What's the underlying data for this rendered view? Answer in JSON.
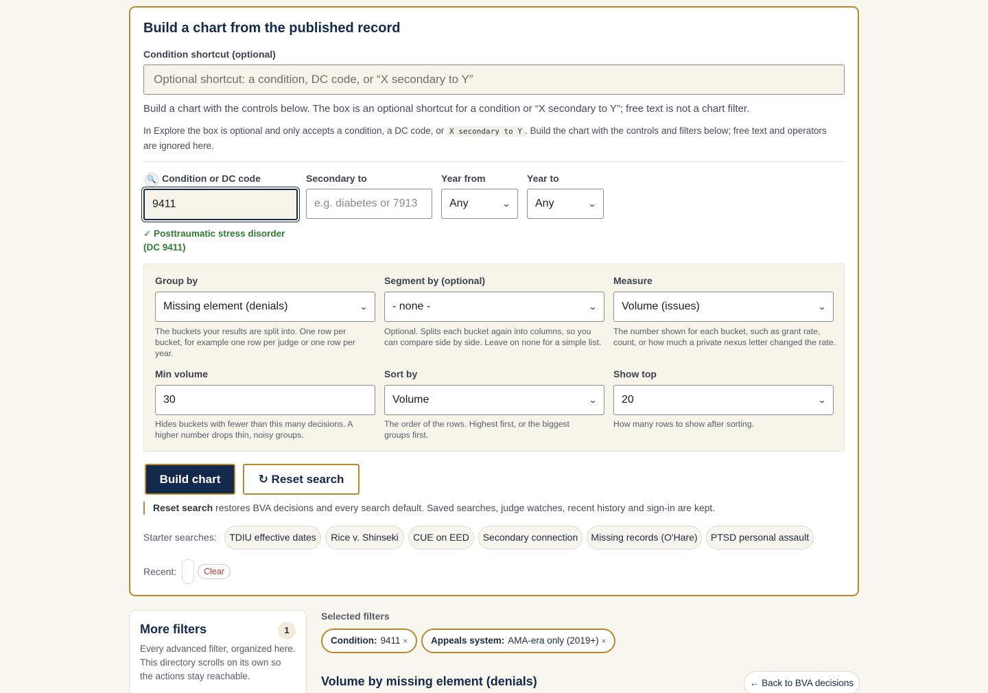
{
  "builder": {
    "title": "Build a chart from the published record",
    "shortcut_label": "Condition shortcut (optional)",
    "shortcut_placeholder": "Optional shortcut: a condition, DC code, or “X secondary to Y”",
    "help_line1": "Build a chart with the controls below. The box is an optional shortcut for a condition or “X secondary to Y”; free text is not a chart filter.",
    "help_line2_a": "In Explore the box is optional and only accepts a condition, a DC code, or ",
    "help_line2_code": "X secondary to Y",
    "help_line2_b": ". Build the chart with the controls and filters below; free text and operators are ignored here.",
    "condition_label": "Condition or DC code",
    "condition_value": "9411",
    "condition_match": "✓ Posttraumatic stress disorder (DC 9411)",
    "secondary_label": "Secondary to",
    "secondary_placeholder": "e.g. diabetes or 7913",
    "year_from_label": "Year from",
    "year_from_value": "Any",
    "year_to_label": "Year to",
    "year_to_value": "Any"
  },
  "options": {
    "group_by_label": "Group by",
    "group_by_value": "Missing element (denials)",
    "group_by_help": "The buckets your results are split into. One row per bucket, for example one row per judge or one row per year.",
    "segment_label": "Segment by (optional)",
    "segment_value": "- none -",
    "segment_help": "Optional. Splits each bucket again into columns, so you can compare side by side. Leave on none for a simple list.",
    "measure_label": "Measure",
    "measure_value": "Volume (issues)",
    "measure_help": "The number shown for each bucket, such as grant rate, count, or how much a private nexus letter changed the rate.",
    "min_volume_label": "Min volume",
    "min_volume_value": "30",
    "min_volume_help": "Hides buckets with fewer than this many decisions. A higher number drops thin, noisy groups.",
    "sort_label": "Sort by",
    "sort_value": "Volume",
    "sort_help": "The order of the rows. Highest first, or the biggest groups first.",
    "show_top_label": "Show top",
    "show_top_value": "20",
    "show_top_help": "How many rows to show after sorting."
  },
  "actions": {
    "build_label": "Build chart",
    "reset_label": "↻ Reset search",
    "reset_note_bold": "Reset search",
    "reset_note_rest": " restores BVA decisions and every search default. Saved searches, judge watches, recent history and sign-in are kept."
  },
  "starters": {
    "label": "Starter searches:",
    "items": [
      "TDIU effective dates",
      "Rice v. Shinseki",
      "CUE on EED",
      "Secondary connection",
      "Missing records (O'Hare)",
      "PTSD personal assault"
    ]
  },
  "recent": {
    "label": "Recent:",
    "clear_label": "Clear"
  },
  "more_filters": {
    "title": "More filters",
    "count": "1",
    "description": "Every advanced filter, organized here. This directory scrolls on its own so the actions stay reachable."
  },
  "selected_filters": {
    "label": "Selected filters",
    "items": [
      {
        "key": "Condition:",
        "value": "9411"
      },
      {
        "key": "Appeals system:",
        "value": "AMA-era only (2019+)"
      }
    ],
    "remove_glyph": "×"
  },
  "results": {
    "title": "Volume by missing element (denials)",
    "back_label": "← Back to BVA decisions"
  }
}
